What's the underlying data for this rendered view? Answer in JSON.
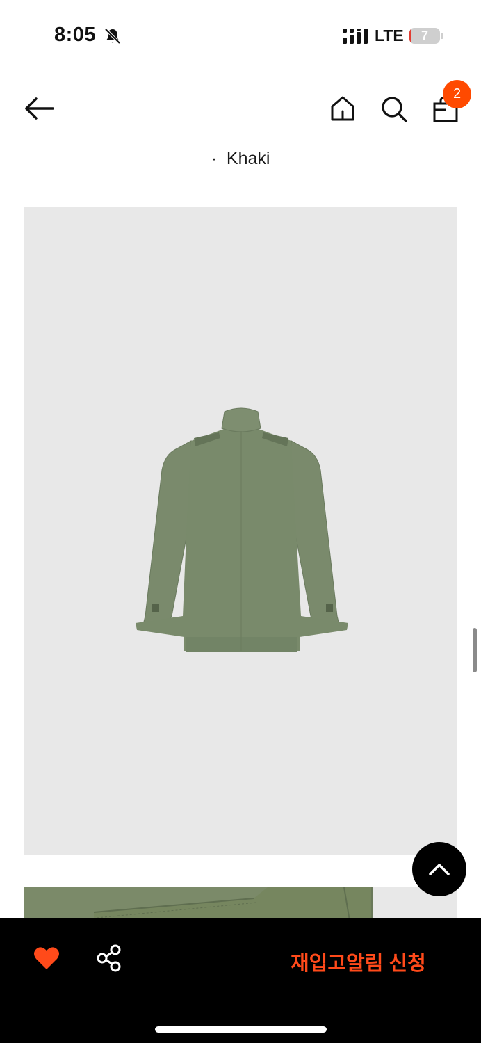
{
  "status_bar": {
    "time": "8:05",
    "network": "LTE",
    "battery_level": "7",
    "battery_fraction": 0.07,
    "icons": [
      "bell-slash-icon",
      "signal-icon",
      "battery-icon"
    ]
  },
  "header": {
    "cart_count": "2",
    "icons": [
      "back-arrow-icon",
      "home-icon",
      "search-icon",
      "shopping-bag-icon"
    ],
    "accent_color": "#ff4a00"
  },
  "product": {
    "color_dot": "·",
    "color_name": "Khaki"
  },
  "bottom_bar": {
    "restock_label": "재입고알림 신청",
    "restock_color": "#ff4a1a",
    "icons": [
      "heart-icon",
      "share-icon",
      "chevron-up-icon"
    ]
  }
}
